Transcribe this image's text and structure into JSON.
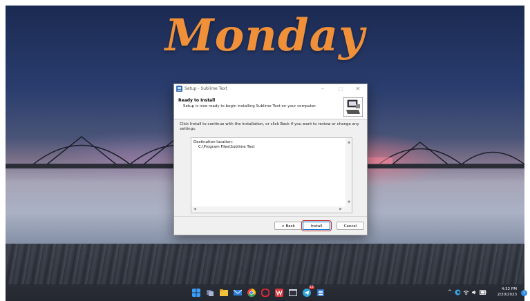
{
  "wallpaper": {
    "word": "Monday",
    "accent": "#f0913a"
  },
  "dialog": {
    "window_title": "Setup - Sublime Text",
    "header_title": "Ready to Install",
    "header_subtitle": "Setup is now ready to begin installing Sublime Text on your computer.",
    "body_text": "Click Install to continue with the installation, or click Back if you want to review or change any settings.",
    "memo_label": "Destination location:",
    "memo_value": "C:\\Program Files\\Sublime Text",
    "buttons": {
      "back": "< Back",
      "install": "Install",
      "cancel": "Cancel"
    },
    "titlebar_buttons": {
      "minimize": "–",
      "maximize": "□",
      "close": "✕"
    }
  },
  "taskbar": {
    "icons": [
      "windows-start-icon",
      "task-view-icon",
      "file-explorer-icon",
      "mail-icon",
      "chrome-icon",
      "opera-icon",
      "wps-icon",
      "terminal-icon",
      "telegram-icon",
      "setup-icon"
    ],
    "telegram_badge": "23",
    "clock_time": "4:32 PM",
    "clock_date": "2/20/2023",
    "notification_count": "1"
  }
}
